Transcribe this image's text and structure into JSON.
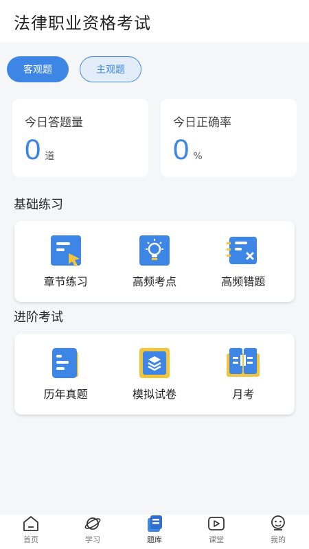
{
  "header": {
    "title": "法律职业资格考试"
  },
  "tabs": [
    {
      "label": "客观题",
      "active": true
    },
    {
      "label": "主观题",
      "active": false
    }
  ],
  "stats": [
    {
      "label": "今日答题量",
      "value": "0",
      "unit": "道"
    },
    {
      "label": "今日正确率",
      "value": "0",
      "unit": "%"
    }
  ],
  "sections": {
    "basic": {
      "title": "基础练习",
      "items": [
        {
          "label": "章节练习",
          "icon": "chapter-practice-icon"
        },
        {
          "label": "高频考点",
          "icon": "lightbulb-icon"
        },
        {
          "label": "高频错题",
          "icon": "wrong-questions-icon"
        }
      ]
    },
    "advanced": {
      "title": "进阶考试",
      "items": [
        {
          "label": "历年真题",
          "icon": "past-papers-icon"
        },
        {
          "label": "模拟试卷",
          "icon": "mock-exam-icon"
        },
        {
          "label": "月考",
          "icon": "monthly-exam-icon"
        }
      ]
    }
  },
  "tabbar": [
    {
      "label": "首页",
      "icon": "home-icon",
      "active": false
    },
    {
      "label": "学习",
      "icon": "planet-icon",
      "active": false
    },
    {
      "label": "题库",
      "icon": "question-bank-icon",
      "active": true
    },
    {
      "label": "课堂",
      "icon": "play-icon",
      "active": false
    },
    {
      "label": "我的",
      "icon": "profile-icon",
      "active": false
    }
  ],
  "colors": {
    "accent": "#3d86e6",
    "icon_yellow": "#f2c53d",
    "background": "#f5f6f8"
  }
}
